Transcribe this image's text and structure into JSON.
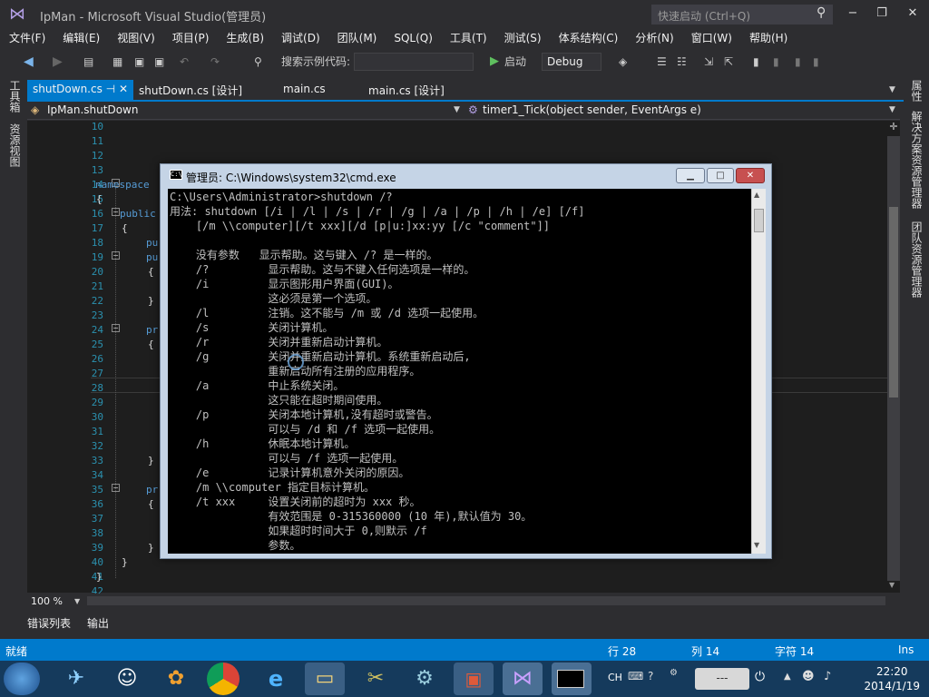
{
  "window": {
    "title": "IpMan - Microsoft Visual Studio(管理员)",
    "quick_launch_placeholder": "快速启动 (Ctrl+Q)",
    "minimize": "−",
    "maximize": "❐",
    "close": "✕"
  },
  "menu": [
    "文件(F)",
    "编辑(E)",
    "视图(V)",
    "项目(P)",
    "生成(B)",
    "调试(D)",
    "团队(M)",
    "SQL(Q)",
    "工具(T)",
    "测试(S)",
    "体系结构(C)",
    "分析(N)",
    "窗口(W)",
    "帮助(H)"
  ],
  "toolbar": {
    "search_label": "搜索示例代码:",
    "start_label": "启动",
    "config": "Debug"
  },
  "side_left": [
    "工具箱",
    "资源视图"
  ],
  "side_right": [
    "属性",
    "解决方案资源管理器",
    "团队资源管理器"
  ],
  "tabs": [
    "shutDown.cs",
    "shutDown.cs [设计]",
    "main.cs",
    "main.cs [设计]"
  ],
  "nav": {
    "class": "IpMan.shutDown",
    "member": "timer1_Tick(object sender, EventArgs e)"
  },
  "code": {
    "line_numbers": [
      "10",
      "11",
      "12",
      "13",
      "14",
      "15",
      "16",
      "17",
      "18",
      "19",
      "20",
      "21",
      "22",
      "23",
      "24",
      "25",
      "26",
      "27",
      "28",
      "29",
      "30",
      "31",
      "32",
      "33",
      "34",
      "35",
      "36",
      "37",
      "38",
      "39",
      "40",
      "41",
      "42"
    ],
    "kw_namespace": "namespace",
    "kw_public": "public",
    "kw_pu": "pu",
    "kw_pr": "pr"
  },
  "zoom": "100 %",
  "bottom_tabs": [
    "错误列表",
    "输出"
  ],
  "status": {
    "ready": "就绪",
    "row": "行 28",
    "col": "列 14",
    "char": "字符 14",
    "mode": "Ins"
  },
  "cmd": {
    "title": "管理员: C:\\Windows\\system32\\cmd.exe",
    "icon_label": "C:\\",
    "lines": [
      "C:\\Users\\Administrator>shutdown /?",
      "用法: shutdown [/i | /l | /s | /r | /g | /a | /p | /h | /e] [/f]",
      "    [/m \\\\computer][/t xxx][/d [p|u:]xx:yy [/c \"comment\"]]",
      "",
      "    没有参数   显示帮助。这与键入 /? 是一样的。",
      "    /?         显示帮助。这与不键入任何选项是一样的。",
      "    /i         显示图形用户界面(GUI)。",
      "               这必须是第一个选项。",
      "    /l         注销。这不能与 /m 或 /d 选项一起使用。",
      "    /s         关闭计算机。",
      "    /r         关闭并重新启动计算机。",
      "    /g         关闭并重新启动计算机。系统重新启动后,",
      "               重新启动所有注册的应用程序。",
      "    /a         中止系统关闭。",
      "               这只能在超时期间使用。",
      "    /p         关闭本地计算机,没有超时或警告。",
      "               可以与 /d 和 /f 选项一起使用。",
      "    /h         休眠本地计算机。",
      "               可以与 /f 选项一起使用。",
      "    /e         记录计算机意外关闭的原因。",
      "    /m \\\\computer 指定目标计算机。",
      "    /t xxx     设置关闭前的超时为 xxx 秒。",
      "               有效范围是 0-315360000 (10 年),默认值为 30。",
      "               如果超时时间大于 0,则默示 /f",
      "               参数。"
    ]
  },
  "taskbar": {
    "lang": "CH",
    "time": "22:20",
    "date": "2014/1/19"
  }
}
